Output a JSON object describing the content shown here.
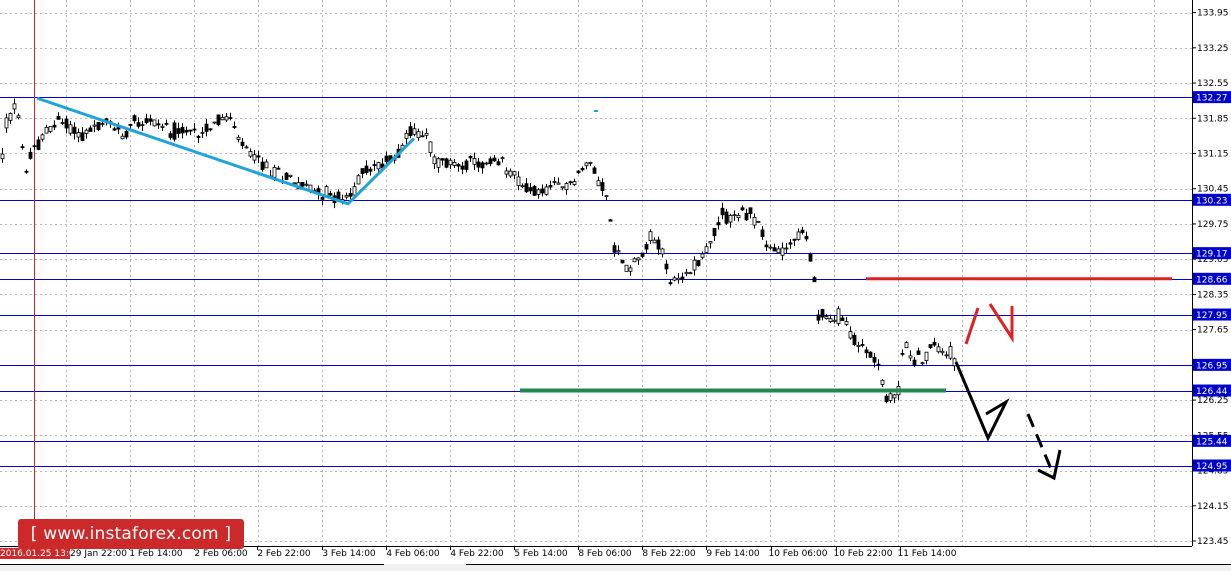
{
  "chart_data": {
    "type": "candlestick",
    "y_axis": {
      "min": 123.45,
      "max": 134.2,
      "position": "right",
      "tick_labels": [
        "133.95",
        "133.25",
        "132.55",
        "131.85",
        "131.15",
        "130.45",
        "129.75",
        "129.05",
        "128.35",
        "127.65",
        "126.25",
        "125.55",
        "124.85",
        "124.15",
        "123.45"
      ]
    },
    "x_axis": {
      "tick_labels": [
        "1 Feb 14:00",
        "2 Feb 06:00",
        "2 Feb 22:00",
        "3 Feb 14:00",
        "4 Feb 06:00",
        "4 Feb 22:00",
        "5 Feb 14:00",
        "8 Feb 06:00",
        "8 Feb 22:00",
        "9 Feb 14:00",
        "10 Feb 06:00",
        "10 Feb 22:00",
        "11 Feb 14:00"
      ],
      "partial_labels": [
        "2016.01.25 13:00",
        "29 Jan 22:00"
      ]
    },
    "grid": true,
    "horizontal_levels": [
      {
        "value": 132.27,
        "label": "132.27"
      },
      {
        "value": 130.23,
        "label": "130.23"
      },
      {
        "value": 129.17,
        "label": "129.17"
      },
      {
        "value": 128.66,
        "label": "128.66"
      },
      {
        "value": 127.95,
        "label": "127.95"
      },
      {
        "value": 126.95,
        "label": "126.95"
      },
      {
        "value": 126.44,
        "label": "126.44"
      },
      {
        "value": 125.44,
        "label": "125.44"
      },
      {
        "value": 124.95,
        "label": "124.95"
      }
    ],
    "drawn_lines": [
      {
        "name": "resistance",
        "color": "#e02020",
        "value": 128.66
      },
      {
        "name": "support",
        "color": "#1f8a4c",
        "value": 126.44
      }
    ],
    "colors": {
      "level": "#0000cc",
      "up_candle": "#ffffff",
      "down_candle": "#000000",
      "trend": "#1fa3dc",
      "vertical": "#e02020"
    }
  },
  "watermark": {
    "text": "[ www.instaforex.com ]"
  }
}
